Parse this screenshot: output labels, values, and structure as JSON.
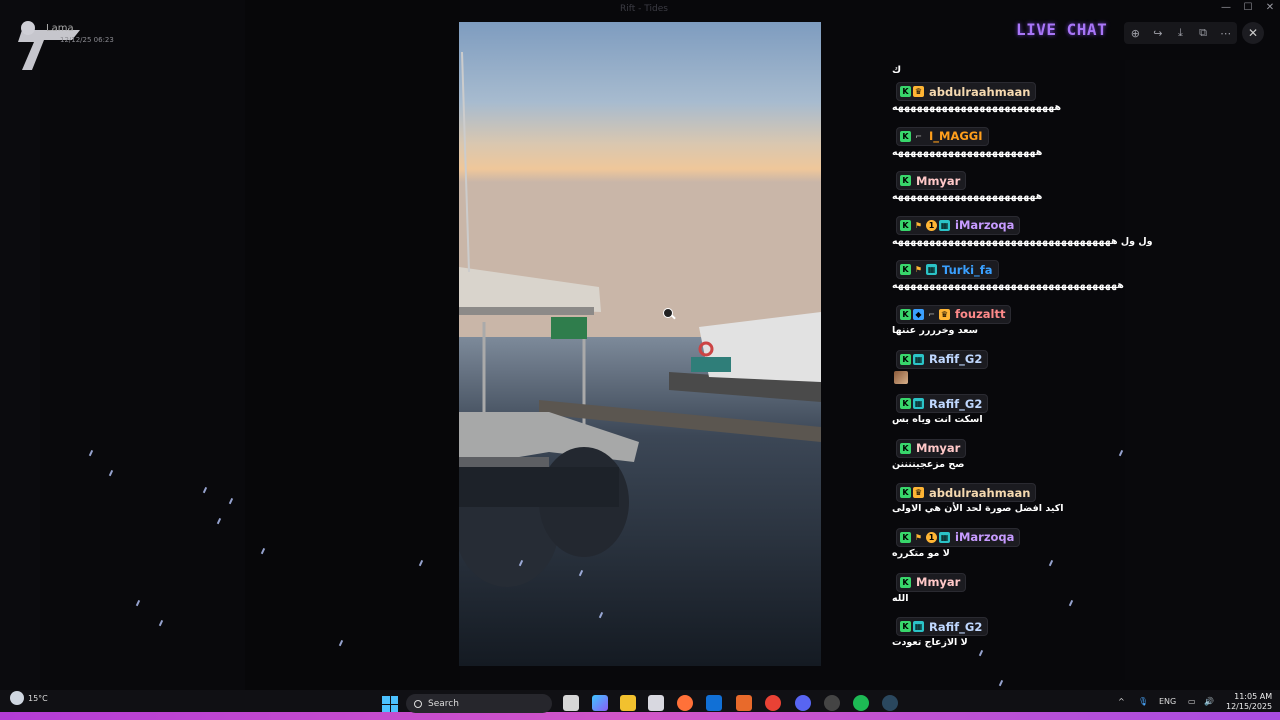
{
  "window": {
    "title": "Rift - Tides"
  },
  "user": {
    "name": "Lama",
    "timestamp": "12/12/25 06:23"
  },
  "overlay": {
    "title": "LIVE CHAT"
  },
  "viewer_toolbar": {
    "icons": [
      "zoom-in-icon",
      "share-icon",
      "download-icon",
      "open-external-icon",
      "more-icon"
    ],
    "close_icon": "close-icon"
  },
  "chat": {
    "first_text": "ك",
    "messages": [
      {
        "username": "abdulraahmaan",
        "color": "#f5d9b0",
        "badges": [
          "k",
          "crown"
        ],
        "text": "ههههههههههههههههههههههههههه"
      },
      {
        "username": "I_MAGGI",
        "color": "#ff9f1c",
        "badges": [
          "k",
          "dash"
        ],
        "text": "هههههههههههههههههههههههه"
      },
      {
        "username": "Mmyar",
        "color": "#ffc8c8",
        "badges": [
          "k"
        ],
        "text": "هههههههههههههههههههههههه"
      },
      {
        "username": "iMarzoqa",
        "color": "#c79bff",
        "badges": [
          "k",
          "flag",
          "one",
          "cube"
        ],
        "text": "ول ول هههههههههههههههههههههههههههههههههههه"
      },
      {
        "username": "Turki_fa",
        "color": "#3aa0ff",
        "badges": [
          "k",
          "flag",
          "cube"
        ],
        "text": "ههههههههههههههههههههههههههههههههههههه"
      },
      {
        "username": "fouzaltt",
        "color": "#ff8a8a",
        "badges": [
          "k",
          "gem",
          "dash",
          "crown"
        ],
        "text": "سعد وخرررر عننها"
      },
      {
        "username": "Rafif_G2",
        "color": "#c0d8ff",
        "badges": [
          "k",
          "cube"
        ],
        "text": "",
        "emote": true
      },
      {
        "username": "Rafif_G2",
        "color": "#c0d8ff",
        "badges": [
          "k",
          "cube"
        ],
        "text": "اسكت انت وياه بس"
      },
      {
        "username": "Mmyar",
        "color": "#ffc8c8",
        "badges": [
          "k"
        ],
        "text": "صح مزعجيننننن"
      },
      {
        "username": "abdulraahmaan",
        "color": "#f5d9b0",
        "badges": [
          "k",
          "crown"
        ],
        "text": "اكيد افضل صورة لحد الأن هي الاولى"
      },
      {
        "username": "iMarzoqa",
        "color": "#c79bff",
        "badges": [
          "k",
          "flag",
          "one",
          "cube"
        ],
        "text": "لا مو متكرره"
      },
      {
        "username": "Mmyar",
        "color": "#ffc8c8",
        "badges": [
          "k"
        ],
        "text": "الله"
      },
      {
        "username": "Rafif_G2",
        "color": "#c0d8ff",
        "badges": [
          "k",
          "cube"
        ],
        "text": "لا الازعاج تعودت"
      }
    ]
  },
  "taskbar": {
    "weather_temp": "15°C",
    "search_placeholder": "Search",
    "language": "ENG",
    "time": "11:05 AM",
    "date": "12/15/2025"
  }
}
